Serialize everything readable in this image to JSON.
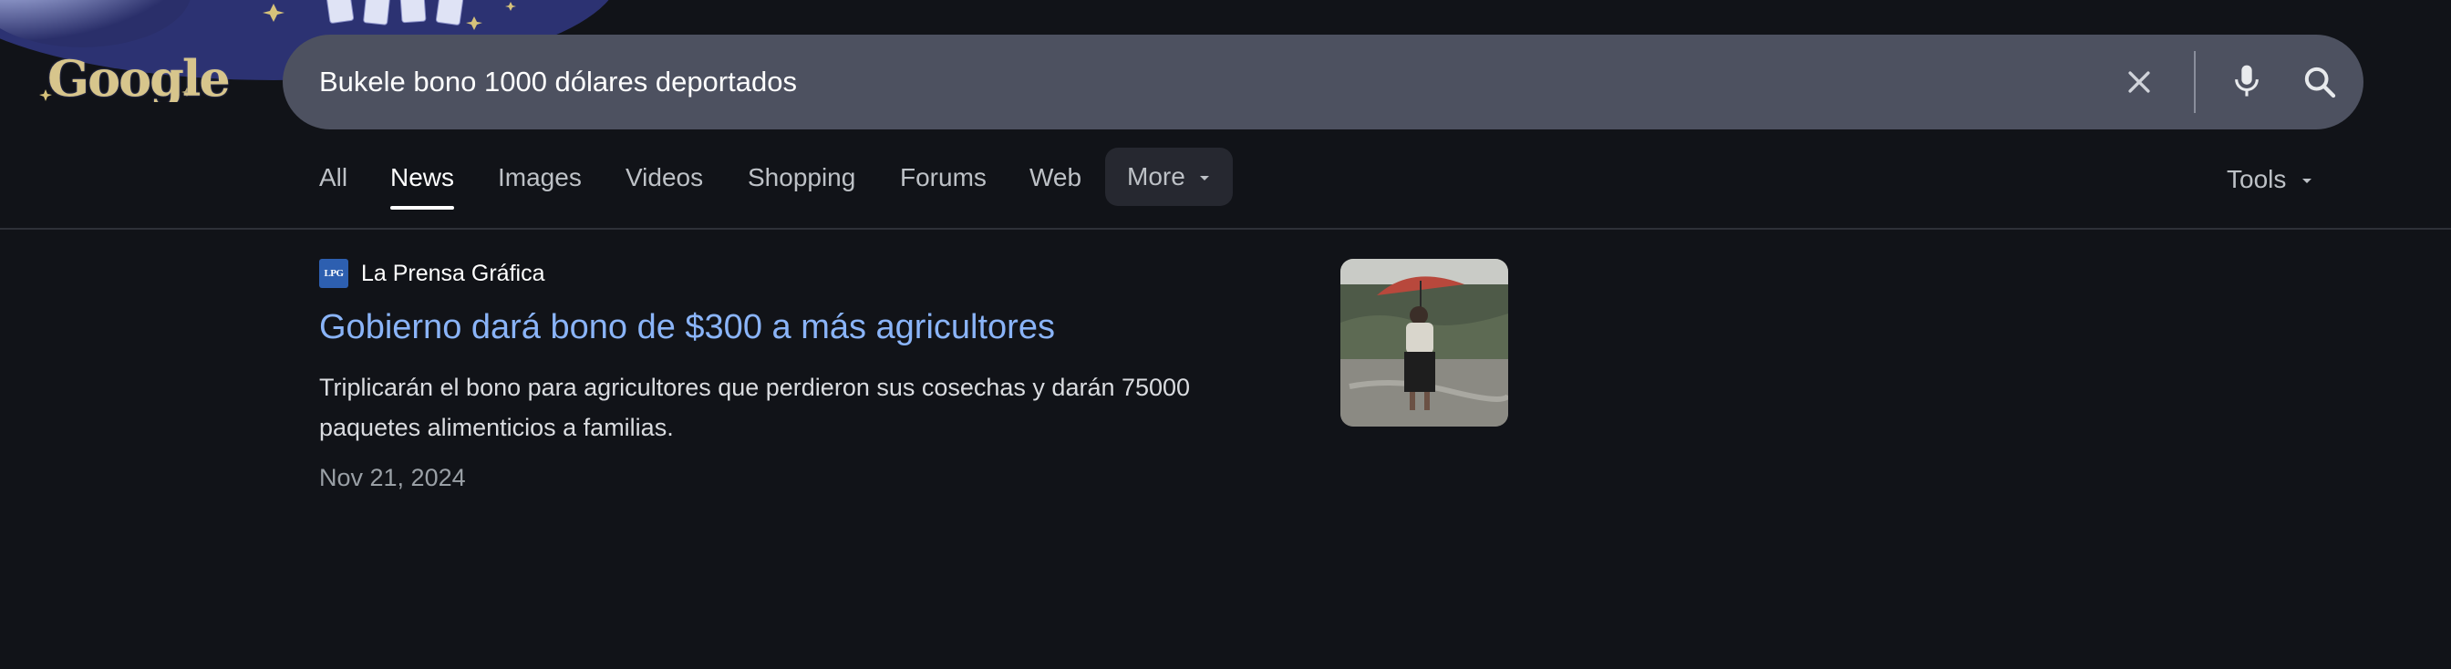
{
  "doodle": {
    "logo_text": "Google",
    "icon": "google-doodle-logo"
  },
  "search": {
    "query": "Bukele bono 1000 dólares deportados",
    "clear_icon": "close-icon",
    "mic_icon": "microphone-icon",
    "search_icon": "search-icon"
  },
  "tabs": {
    "all": "All",
    "news": "News",
    "images": "Images",
    "videos": "Videos",
    "shopping": "Shopping",
    "forums": "Forums",
    "web": "Web",
    "more": "More",
    "tools": "Tools",
    "active": "News"
  },
  "result": {
    "favicon_text": "LPG",
    "source": "La Prensa Gráfica",
    "title": "Gobierno dará bono de $300 a más agricultores",
    "snippet": "Triplicarán el bono para agricultores que perdieron sus cosechas y darán 75000 paquetes alimenticios a familias.",
    "date": "Nov 21, 2024",
    "thumbnail_icon": "news-thumbnail-image"
  },
  "colors": {
    "background": "#111318",
    "searchbox": "#4d5160",
    "link": "#8ab4f8",
    "favicon": "#2d5fb0"
  }
}
